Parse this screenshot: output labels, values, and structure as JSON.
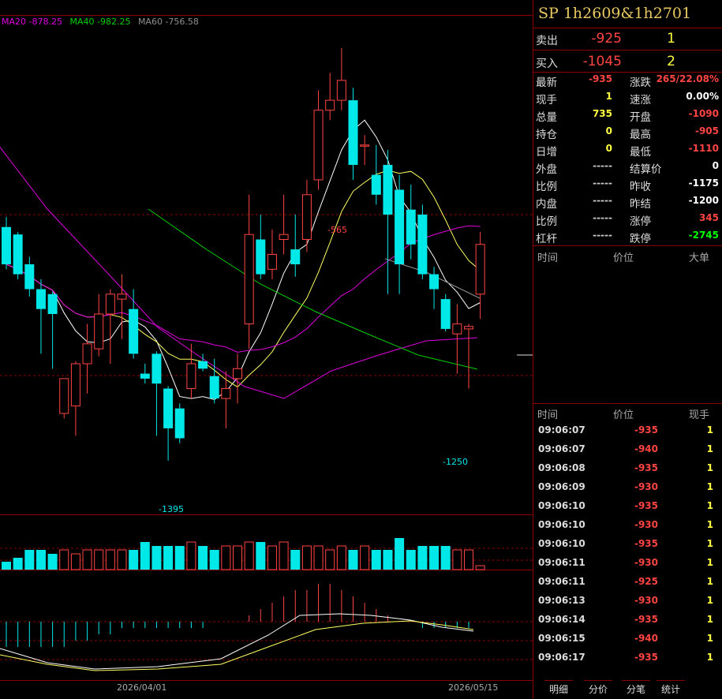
{
  "ma": {
    "ma20": "MA20 -878.25",
    "ma40": "MA40 -982.25",
    "ma60": "MA60 -756.58"
  },
  "colors": {
    "up": "#ff4444",
    "down": "#00e8e8",
    "ma5": "#ffffff",
    "ma10": "#ffff60",
    "ma20": "#e000e0",
    "ma40": "#00d000",
    "ma60": "#909090",
    "grid": "#8b0000"
  },
  "annotations": {
    "high": "-565",
    "low": "-1395",
    "low2": "-1250"
  },
  "dates": {
    "d1": "2026/04/01",
    "d2": "2026/05/15"
  },
  "chart_data": {
    "type": "candlestick",
    "price_range": [
      -1500,
      -500
    ],
    "candles": [
      {
        "o": -925,
        "c": -1000,
        "h": -905,
        "l": -1010
      },
      {
        "o": -940,
        "c": -1020,
        "h": -935,
        "l": -1030
      },
      {
        "o": -1000,
        "c": -1050,
        "h": -985,
        "l": -1065
      },
      {
        "o": -1050,
        "c": -1090,
        "h": -1030,
        "l": -1180
      },
      {
        "o": -1060,
        "c": -1100,
        "h": -1055,
        "l": -1210
      },
      {
        "o": -1300,
        "c": -1230,
        "h": -1230,
        "l": -1310
      },
      {
        "o": -1285,
        "c": -1200,
        "h": -1195,
        "l": -1345
      },
      {
        "o": -1200,
        "c": -1160,
        "h": -1120,
        "l": -1260
      },
      {
        "o": -1170,
        "c": -1100,
        "h": -1060,
        "l": -1185
      },
      {
        "o": -1100,
        "c": -1060,
        "h": -1050,
        "l": -1200
      },
      {
        "o": -1070,
        "c": -1060,
        "h": -1020,
        "l": -1150
      },
      {
        "o": -1090,
        "c": -1180,
        "h": -1050,
        "l": -1190
      },
      {
        "o": -1220,
        "c": -1230,
        "h": -1200,
        "l": -1240
      },
      {
        "o": -1180,
        "c": -1240,
        "h": -1175,
        "l": -1345
      },
      {
        "o": -1250,
        "c": -1330,
        "h": -1245,
        "l": -1395
      },
      {
        "o": -1290,
        "c": -1350,
        "h": -1280,
        "l": -1360
      },
      {
        "o": -1250,
        "c": -1200,
        "h": -1160,
        "l": -1270
      },
      {
        "o": -1195,
        "c": -1210,
        "h": -1180,
        "l": -1215
      },
      {
        "o": -1225,
        "c": -1270,
        "h": -1190,
        "l": -1280
      },
      {
        "o": -1270,
        "c": -1250,
        "h": -1215,
        "l": -1330
      },
      {
        "o": -1230,
        "c": -1210,
        "h": -1180,
        "l": -1280
      },
      {
        "o": -1120,
        "c": -940,
        "h": -860,
        "l": -1170
      },
      {
        "o": -950,
        "c": -1020,
        "h": -900,
        "l": -1030
      },
      {
        "o": -1010,
        "c": -980,
        "h": -930,
        "l": -1030
      },
      {
        "o": -950,
        "c": -940,
        "h": -860,
        "l": -980
      },
      {
        "o": -970,
        "c": -1000,
        "h": -900,
        "l": -1025
      },
      {
        "o": -950,
        "c": -860,
        "h": -830,
        "l": -975
      },
      {
        "o": -830,
        "c": -690,
        "h": -650,
        "l": -850
      },
      {
        "o": -690,
        "c": -670,
        "h": -615,
        "l": -710
      },
      {
        "o": -670,
        "c": -630,
        "h": -565,
        "l": -690
      },
      {
        "o": -670,
        "c": -800,
        "h": -645,
        "l": -830
      },
      {
        "o": -760,
        "c": -760,
        "h": -740,
        "l": -800
      },
      {
        "o": -820,
        "c": -860,
        "h": -760,
        "l": -880
      },
      {
        "o": -800,
        "c": -900,
        "h": -770,
        "l": -1060
      },
      {
        "o": -850,
        "c": -1000,
        "h": -820,
        "l": -1060
      },
      {
        "o": -890,
        "c": -960,
        "h": -840,
        "l": -990
      },
      {
        "o": -900,
        "c": -1020,
        "h": -880,
        "l": -1030
      },
      {
        "o": -1020,
        "c": -1050,
        "h": -1005,
        "l": -1090
      },
      {
        "o": -1070,
        "c": -1130,
        "h": -1060,
        "l": -1135
      },
      {
        "o": -1140,
        "c": -1120,
        "h": -1080,
        "l": -1220
      },
      {
        "o": -1130,
        "c": -1125,
        "h": -1120,
        "l": -1250
      },
      {
        "o": -1060,
        "c": -960,
        "h": -935,
        "l": -1110
      }
    ],
    "volume": [
      2,
      3,
      5,
      5,
      4,
      5,
      4,
      5,
      5,
      5,
      5,
      5,
      7,
      6,
      6,
      6,
      7,
      6,
      5,
      6,
      6,
      7,
      7,
      6,
      7,
      5,
      6,
      6,
      5,
      6,
      5,
      6,
      5,
      5,
      8,
      5,
      6,
      6,
      6,
      5,
      5,
      1
    ],
    "macd_bars": [
      -4,
      -4,
      -4,
      -4,
      -4,
      -4,
      -3,
      -3,
      -2,
      -2,
      -1,
      -1,
      -1,
      -1,
      -1,
      -1,
      -1,
      -1,
      0,
      0,
      0,
      1,
      2,
      3,
      4,
      5,
      5,
      6,
      6,
      5,
      4,
      3,
      2,
      1,
      0,
      0,
      -1,
      -1,
      -1,
      -1,
      -1,
      0
    ]
  },
  "panel": {
    "title": "SP  1h2609&1h2701",
    "sell": {
      "label": "卖出",
      "price": "-925",
      "vol": "1"
    },
    "buy": {
      "label": "买入",
      "price": "-1045",
      "vol": "2"
    },
    "stats_left": [
      {
        "k": "最新",
        "v": "-935",
        "c": "#ff4444"
      },
      {
        "k": "现手",
        "v": "1",
        "c": "#ffff40"
      },
      {
        "k": "总量",
        "v": "735",
        "c": "#ffff40"
      },
      {
        "k": "持仓",
        "v": "0",
        "c": "#ffff40"
      },
      {
        "k": "日增",
        "v": "0",
        "c": "#ffff40"
      },
      {
        "k": "外盘",
        "v": "-----",
        "c": "#ccc"
      },
      {
        "k": "比例",
        "v": "-----",
        "c": "#ccc"
      },
      {
        "k": "内盘",
        "v": "-----",
        "c": "#ccc"
      },
      {
        "k": "比例",
        "v": "-----",
        "c": "#ccc"
      },
      {
        "k": "杠杆",
        "v": "-----",
        "c": "#ccc"
      }
    ],
    "stats_right": [
      {
        "k": "涨跌",
        "v": "265/22.08%",
        "c": "#ff4444"
      },
      {
        "k": "速涨",
        "v": "0.00%",
        "c": "#fff"
      },
      {
        "k": "开盘",
        "v": "-1090",
        "c": "#ff4444"
      },
      {
        "k": "最高",
        "v": "-905",
        "c": "#ff4444"
      },
      {
        "k": "最低",
        "v": "-1110",
        "c": "#ff4444"
      },
      {
        "k": "结算价",
        "v": "0",
        "c": "#fff"
      },
      {
        "k": "昨收",
        "v": "-1175",
        "c": "#fff"
      },
      {
        "k": "昨结",
        "v": "-1200",
        "c": "#fff"
      },
      {
        "k": "涨停",
        "v": "345",
        "c": "#ff4444"
      },
      {
        "k": "跌停",
        "v": "-2745",
        "c": "#00ff00"
      }
    ],
    "bigorder_hdr": {
      "time": "时间",
      "price": "价位",
      "size": "大单"
    },
    "tick_hdr": {
      "time": "时间",
      "price": "价位",
      "vol": "现手"
    },
    "ticks": [
      {
        "t": "09:06:07",
        "p": "-935",
        "q": "1"
      },
      {
        "t": "09:06:07",
        "p": "-940",
        "q": "1"
      },
      {
        "t": "09:06:08",
        "p": "-935",
        "q": "1"
      },
      {
        "t": "09:06:09",
        "p": "-930",
        "q": "1"
      },
      {
        "t": "09:06:10",
        "p": "-935",
        "q": "1"
      },
      {
        "t": "09:06:10",
        "p": "-930",
        "q": "1"
      },
      {
        "t": "09:06:10",
        "p": "-935",
        "q": "1"
      },
      {
        "t": "09:06:11",
        "p": "-930",
        "q": "1"
      },
      {
        "t": "09:06:11",
        "p": "-925",
        "q": "1"
      },
      {
        "t": "09:06:13",
        "p": "-930",
        "q": "1"
      },
      {
        "t": "09:06:14",
        "p": "-935",
        "q": "1"
      },
      {
        "t": "09:06:15",
        "p": "-940",
        "q": "1"
      },
      {
        "t": "09:06:17",
        "p": "-935",
        "q": "1"
      }
    ],
    "tabs": [
      "明细",
      "分价",
      "分笔",
      "统计"
    ]
  }
}
